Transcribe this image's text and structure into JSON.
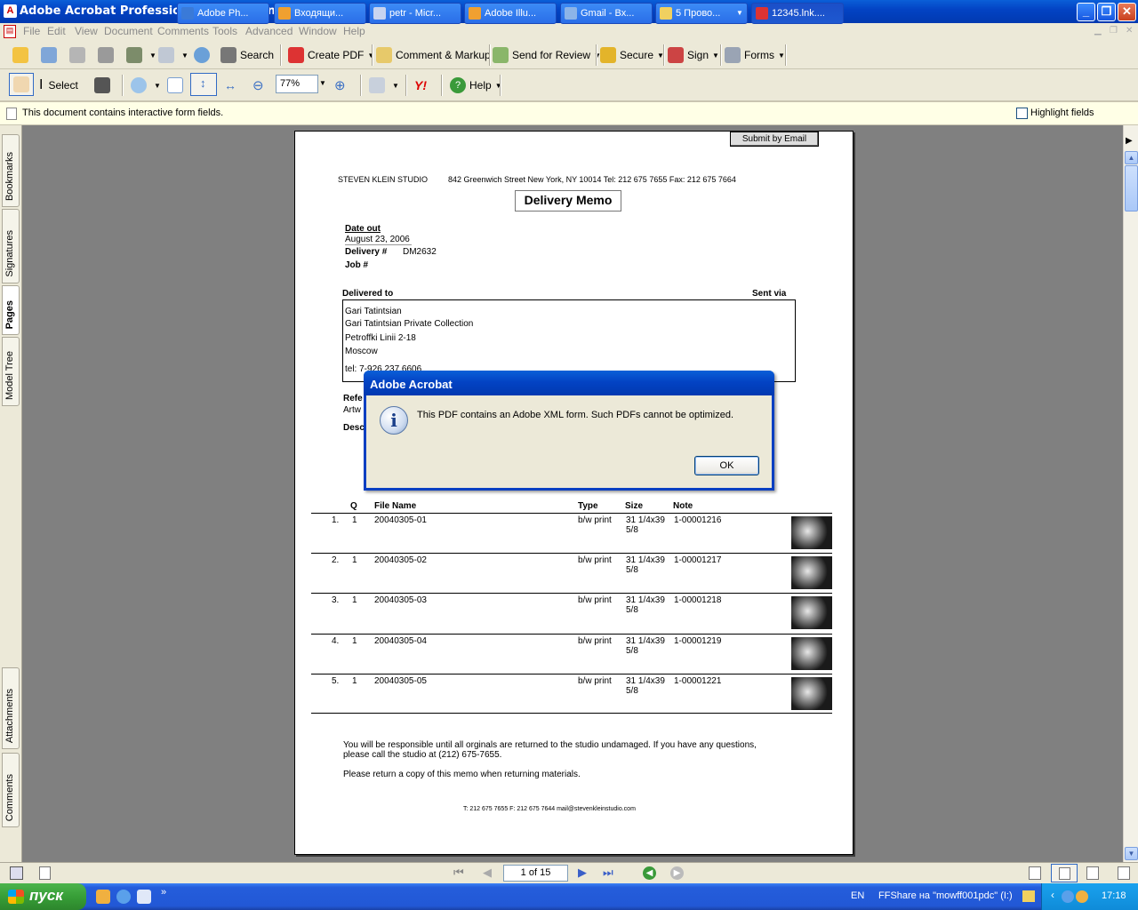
{
  "window": {
    "title": "Adobe Acrobat Professional - [12345.lnk.pdf]",
    "app_icon": "adobe-acrobat-icon",
    "controls": [
      "_",
      "❐",
      "✕"
    ]
  },
  "menu": [
    "File",
    "Edit",
    "View",
    "Document",
    "Comments",
    "Tools",
    "Advanced",
    "Window",
    "Help"
  ],
  "toolbar1": {
    "search": "Search",
    "create_pdf": "Create PDF",
    "comment_markup": "Comment & Markup",
    "send_review": "Send for Review",
    "secure": "Secure",
    "sign": "Sign",
    "forms": "Forms"
  },
  "toolbar2": {
    "select": "Select",
    "zoom_value": "77%",
    "help": "Help",
    "yahoo": "Y!"
  },
  "message_bar": {
    "text": "This document contains interactive form fields.",
    "highlight": "Highlight fields"
  },
  "left_tabs": [
    "Bookmarks",
    "Signatures",
    "Pages",
    "Model Tree",
    "Attachments",
    "Comments"
  ],
  "document": {
    "submit": "Submit by Email",
    "studio": "STEVEN KLEIN STUDIO",
    "address": "842 Greenwich Street  New York, NY 10014  Tel: 212 675 7655  Fax:  212 675 7664",
    "heading": "Delivery Memo",
    "date_out_label": "Date out",
    "date_out_value": "August 23, 2006",
    "delivery_label": "Delivery #",
    "delivery_value": "DM2632",
    "job_label": "Job #",
    "delivered_to_label": "Delivered to",
    "sent_via_label": "Sent via",
    "recipient": [
      "Gari Tatintsian",
      "Gari Tatintsian Private Collection",
      "Petroffki Linii 2-18",
      "Moscow"
    ],
    "tel": "tel: 7-926 237 6606",
    "ref_label": "Refe",
    "artw_label": "Artw",
    "desc_label": "Desc",
    "table_headers": {
      "q": "Q",
      "file": "File Name",
      "type": "Type",
      "size": "Size",
      "note": "Note"
    },
    "rows": [
      {
        "n": "1.",
        "q": "1",
        "file": "20040305-01",
        "type": "b/w print",
        "size1": "31 1/4x39",
        "size2": "5/8",
        "note": "1-00001216"
      },
      {
        "n": "2.",
        "q": "1",
        "file": "20040305-02",
        "type": "b/w print",
        "size1": "31 1/4x39",
        "size2": "5/8",
        "note": "1-00001217"
      },
      {
        "n": "3.",
        "q": "1",
        "file": "20040305-03",
        "type": "b/w print",
        "size1": "31 1/4x39",
        "size2": "5/8",
        "note": "1-00001218"
      },
      {
        "n": "4.",
        "q": "1",
        "file": "20040305-04",
        "type": "b/w print",
        "size1": "31 1/4x39",
        "size2": "5/8",
        "note": "1-00001219"
      },
      {
        "n": "5.",
        "q": "1",
        "file": "20040305-05",
        "type": "b/w print",
        "size1": "31 1/4x39",
        "size2": "5/8",
        "note": "1-00001221"
      }
    ],
    "footer1": "You will be responsible until all orginals are returned to the studio undamaged.  If you have any questions,",
    "footer2": "please call the studio at (212) 675-7655.",
    "footer3": "Please return a copy of this memo when returning materials.",
    "footer_contact": "T: 212 675 7655  F: 212 675  7644  mail@stevenkleinstudio.com"
  },
  "dialog": {
    "title": "Adobe Acrobat",
    "message": "This PDF contains an Adobe XML form. Such PDFs cannot be optimized.",
    "ok": "OK",
    "icon": "info-icon"
  },
  "statusbar": {
    "page": "1 of 15"
  },
  "taskbar": {
    "start": "пуск",
    "tasks": [
      "Adobe Ph...",
      "Входящи...",
      "petr - Micr...",
      "Adobe Illu...",
      "Gmail - Вх...",
      "5 Прово...",
      "12345.lnk...."
    ],
    "lang": "EN",
    "tray_text": "FFShare на \"mowff001pdc\" (I:)",
    "clock": "17:18"
  },
  "colors": {
    "xp_blue": "#0343c4",
    "toolbar_bg": "#ece9d8",
    "doc_bg": "#808080",
    "message_bar": "#ffffe6"
  }
}
